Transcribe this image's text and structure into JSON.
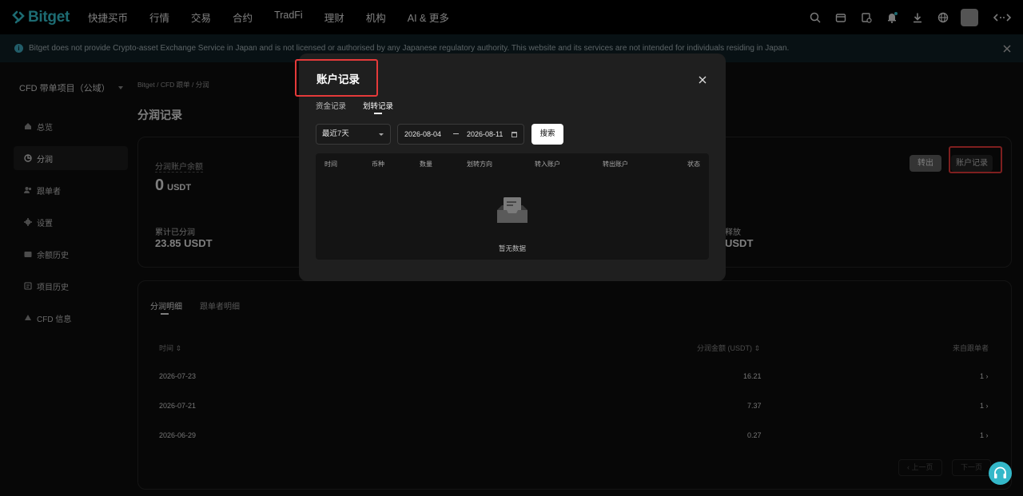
{
  "brand": {
    "name": "Bitget",
    "accent": "#35c3d0"
  },
  "topnav": {
    "items": [
      "快捷买币",
      "行情",
      "交易",
      "合约",
      "TradFi",
      "理财",
      "机构",
      "AI & 更多"
    ]
  },
  "banner": {
    "text": "Bitget does not provide Crypto-asset Exchange Service in Japan and is not licensed or authorised by any Japanese regulatory authority. This website and its services are not intended for individuals residing in Japan."
  },
  "sidebar": {
    "project_select": "CFD 带单项目（公域）",
    "items": [
      {
        "label": "总览",
        "icon": "home-icon"
      },
      {
        "label": "分润",
        "icon": "pie-chart-icon"
      },
      {
        "label": "跟单者",
        "icon": "users-icon"
      },
      {
        "label": "设置",
        "icon": "gear-icon"
      },
      {
        "label": "余额历史",
        "icon": "wallet-icon"
      },
      {
        "label": "项目历史",
        "icon": "history-icon"
      },
      {
        "label": "CFD 信息",
        "icon": "info-icon"
      }
    ],
    "active_index": 1
  },
  "breadcrumb": "Bitget  /  CFD 跟单  /  分润",
  "page_title": "分润记录",
  "summary": {
    "account_label": "分润账户余额",
    "account_value": "0",
    "account_unit": "USDT",
    "cumulative_label": "累计已分润",
    "cumulative_value": "23.85 USDT",
    "release_label": "释放",
    "release_value": "USDT",
    "transfer_out": "转出",
    "account_records": "账户记录"
  },
  "details": {
    "tabs": [
      "分润明细",
      "跟单者明细"
    ],
    "columns": {
      "time": "时间 ⇕",
      "amount": "分润金额 (USDT) ⇕",
      "from": "来自跟单者"
    },
    "rows": [
      {
        "date": "2026-07-23",
        "amount": "16.21",
        "from": "1 ›"
      },
      {
        "date": "2026-07-21",
        "amount": "7.37",
        "from": "1 ›"
      },
      {
        "date": "2026-06-29",
        "amount": "0.27",
        "from": "1 ›"
      }
    ],
    "prev": "‹  上一页",
    "next": "下一页"
  },
  "modal": {
    "title": "账户记录",
    "tabs": [
      "资金记录",
      "划转记录"
    ],
    "active_tab": 1,
    "period": "最近7天",
    "date_start": "2026-08-04",
    "date_end": "2026-08-11",
    "search": "搜索",
    "columns": [
      "时间",
      "币种",
      "数量",
      "划转方向",
      "转入账户",
      "转出账户",
      "状态"
    ],
    "empty_text": "暂无数据"
  }
}
